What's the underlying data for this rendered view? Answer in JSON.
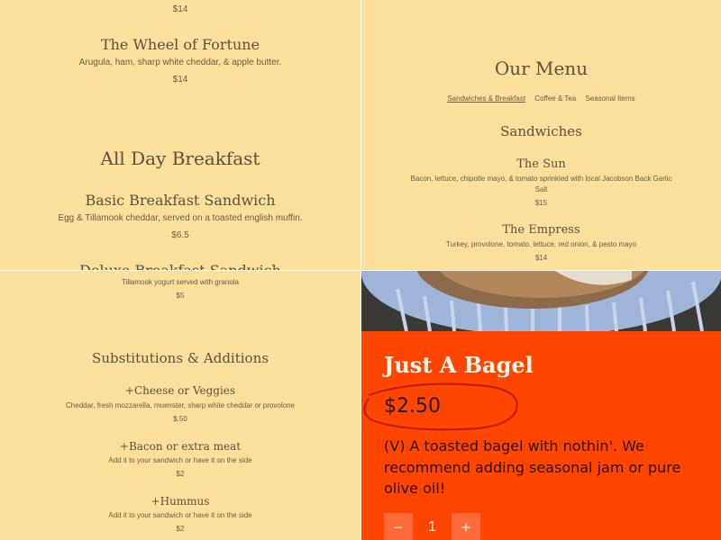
{
  "top_left": {
    "price_top": "$14",
    "item1": {
      "name": "The Wheel of Fortune",
      "desc": "Arugula, ham, sharp white cheddar, & apple butter.",
      "price": "$14"
    },
    "section_title": "All Day Breakfast",
    "item2": {
      "name": "Basic Breakfast Sandwich",
      "desc": "Egg & Tillamook cheddar, served on a toasted english muffin.",
      "price": "$6.5"
    },
    "item3_partial": "Deluxe Breakfast Sandwich"
  },
  "top_right": {
    "menu_title": "Our Menu",
    "tabs": [
      "Sandwiches & Breakfast",
      "Coffee & Tea",
      "Seasonal Items"
    ],
    "section_title": "Sandwiches",
    "item1": {
      "name": "The Sun",
      "desc_line1": "Bacon, lettuce, chipotle mayo, & tomato sprinkled with local Jacobson Back Garlic",
      "desc_line2": "Salt",
      "price": "$15"
    },
    "item2": {
      "name": "The Empress",
      "desc": "Turkey, provolone, tomato, lettuce, red onion, & pesto mayo",
      "price": "$14"
    }
  },
  "bottom_left": {
    "yogurt_desc": "Tillamook yogurt served with granola",
    "yogurt_price": "$5",
    "section_title": "Substitutions & Additions",
    "item1": {
      "name": "+Cheese or Veggies",
      "desc": "Cheddar, fresh mozzarella, muenster, sharp white cheddar or provolone",
      "price": "$.50"
    },
    "item2": {
      "name": "+Bacon or extra meat",
      "desc": "Add it to your sandwich or have it on the side",
      "price": "$2"
    },
    "item3": {
      "name": "+Hummus",
      "desc": "Add it to your sandwich or have it on the side",
      "price": "$2"
    }
  },
  "bottom_right": {
    "product_title": "Just A Bagel",
    "price": "$2.50",
    "description": "(V) A toasted bagel with nothin'. We recommend adding seasonal jam or pure olive oil!",
    "quantity": "1",
    "minus_label": "−",
    "plus_label": "+"
  },
  "colors": {
    "cream": "#fae09a",
    "orange": "#ff4500",
    "brown_text": "#5e5040"
  }
}
